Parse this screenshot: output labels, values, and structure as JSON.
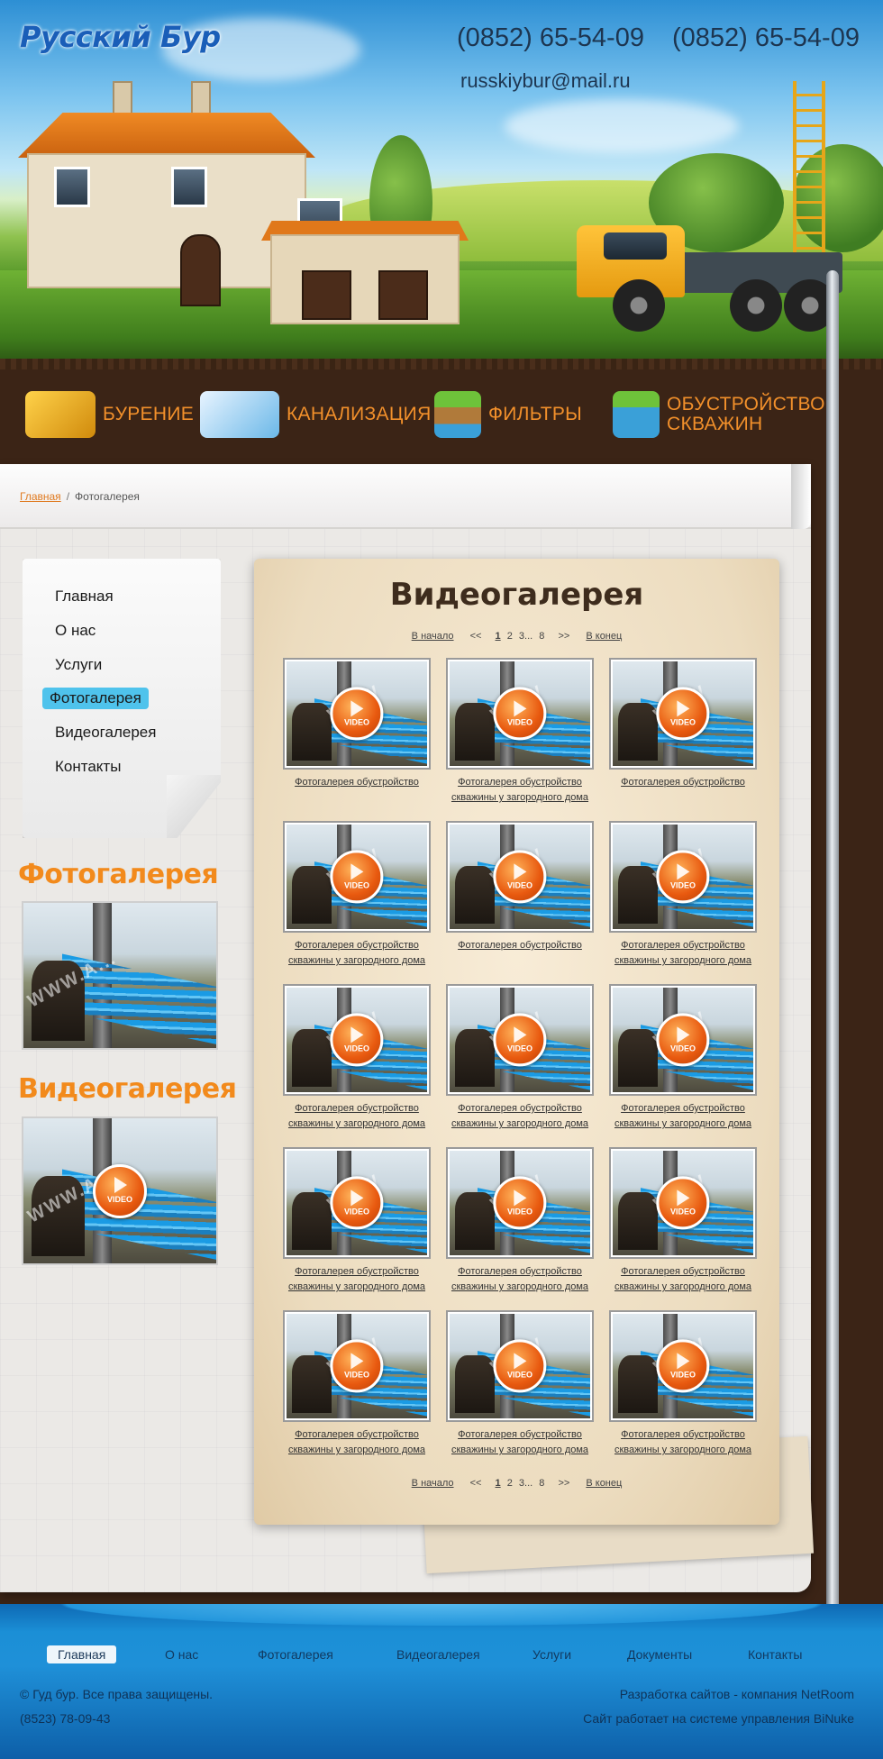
{
  "header": {
    "logo": "Русский Бур",
    "phone1": "(0852) 65-54-09",
    "phone2": "(0852) 65-54-09",
    "email": "russkiybur@mail.ru"
  },
  "topnav": [
    {
      "label": "Бурение",
      "icon": "drill-rig-icon"
    },
    {
      "label": "Канализация",
      "icon": "sewer-tank-icon"
    },
    {
      "label": "Фильтры",
      "icon": "filter-icon"
    },
    {
      "label": "Обустройство скважин",
      "icon": "well-cap-icon"
    }
  ],
  "breadcrumb": {
    "home": "Главная",
    "sep": "/",
    "current": "Фотогалерея"
  },
  "sidemenu": [
    "Главная",
    "О нас",
    "Услуги",
    "Фотогалерея",
    "Видеогалерея",
    "Контакты"
  ],
  "sidemenu_active": "Фотогалерея",
  "sidebar": {
    "photo_title": "Фотогалерея",
    "video_title": "Видеогалерея",
    "watermark": "WWW.A...",
    "video_badge": "VIDEO"
  },
  "gallery": {
    "title": "Видеогалерея",
    "pager": {
      "first": "В начало",
      "prev": "<<",
      "pages": [
        "1",
        "2",
        "3...",
        "8"
      ],
      "current": "1",
      "next": ">>",
      "last": "В конец"
    },
    "video_badge": "VIDEO",
    "watermark": "WWW",
    "items": [
      "Фотогалерея обустройство",
      "Фотогалерея обустройство скважины у загородного дома",
      "Фотогалерея обустройство",
      "Фотогалерея обустройство скважины у загородного дома",
      "Фотогалерея обустройство",
      "Фотогалерея обустройство скважины у загородного дома",
      "Фотогалерея обустройство скважины у загородного дома",
      "Фотогалерея обустройство скважины у загородного дома",
      "Фотогалерея обустройство скважины у загородного дома",
      "Фотогалерея обустройство скважины у загородного дома",
      "Фотогалерея обустройство скважины у загородного дома",
      "Фотогалерея обустройство скважины у загородного дома",
      "Фотогалерея обустройство скважины у загородного дома",
      "Фотогалерея обустройство скважины у загородного дома",
      "Фотогалерея обустройство скважины у загородного дома"
    ]
  },
  "footer": {
    "nav": [
      "Главная",
      "О нас",
      "Фотогалерея",
      "Видеогалерея",
      "Услуги",
      "Документы",
      "Контакты"
    ],
    "nav_active": "Главная",
    "copyright": "© Гуд бур. Все права защищены.",
    "phone": "(8523) 78-09-43",
    "dev": "Разработка сайтов - компания NetRoom",
    "cms": "Сайт работает на системе управления BiNuke"
  },
  "colors": {
    "accent": "#f28a1c",
    "menu_active": "#4fc3ec",
    "footer_bg": "#1b8fd6",
    "paper": "#f3e6d0"
  }
}
